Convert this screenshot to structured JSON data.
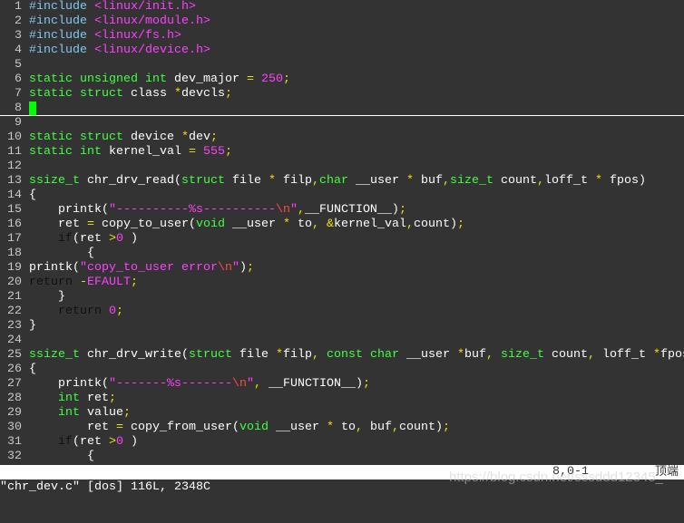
{
  "editor": {
    "colors": {
      "background": "#333333",
      "preprocessor": "#7cc8ec",
      "string": "#ff40ff",
      "type": "#40ff40",
      "operator": "#e8e800",
      "statement": "#111111",
      "special": "#ff4848",
      "cursor": "#00ff00"
    },
    "cursor_line": 8,
    "lines": [
      {
        "n": "1",
        "seg": [
          [
            "pp",
            "#include"
          ],
          [
            "tx",
            " "
          ],
          [
            "str",
            "<linux/init.h>"
          ]
        ]
      },
      {
        "n": "2",
        "seg": [
          [
            "pp",
            "#include"
          ],
          [
            "tx",
            " "
          ],
          [
            "str",
            "<linux/module.h>"
          ]
        ]
      },
      {
        "n": "3",
        "seg": [
          [
            "pp",
            "#include"
          ],
          [
            "tx",
            " "
          ],
          [
            "str",
            "<linux/fs.h>"
          ]
        ]
      },
      {
        "n": "4",
        "seg": [
          [
            "pp",
            "#include"
          ],
          [
            "tx",
            " "
          ],
          [
            "str",
            "<linux/device.h>"
          ]
        ]
      },
      {
        "n": "5",
        "seg": []
      },
      {
        "n": "6",
        "seg": [
          [
            "ty",
            "static"
          ],
          [
            "tx",
            " "
          ],
          [
            "ty",
            "unsigned"
          ],
          [
            "tx",
            " "
          ],
          [
            "ty",
            "int"
          ],
          [
            "tx",
            " dev_major "
          ],
          [
            "op",
            "="
          ],
          [
            "tx",
            " "
          ],
          [
            "str",
            "250"
          ],
          [
            "op",
            ";"
          ]
        ]
      },
      {
        "n": "7",
        "seg": [
          [
            "ty",
            "static"
          ],
          [
            "tx",
            " "
          ],
          [
            "ty",
            "struct"
          ],
          [
            "tx",
            " class "
          ],
          [
            "op",
            "*"
          ],
          [
            "tx",
            "devcls"
          ],
          [
            "op",
            ";"
          ]
        ]
      },
      {
        "n": "8",
        "seg": [],
        "cursor": true
      },
      {
        "n": "9",
        "seg": []
      },
      {
        "n": "10",
        "seg": [
          [
            "ty",
            "static"
          ],
          [
            "tx",
            " "
          ],
          [
            "ty",
            "struct"
          ],
          [
            "tx",
            " device "
          ],
          [
            "op",
            "*"
          ],
          [
            "tx",
            "dev"
          ],
          [
            "op",
            ";"
          ]
        ]
      },
      {
        "n": "11",
        "seg": [
          [
            "ty",
            "static"
          ],
          [
            "tx",
            " "
          ],
          [
            "ty",
            "int"
          ],
          [
            "tx",
            " kernel_val "
          ],
          [
            "op",
            "="
          ],
          [
            "tx",
            " "
          ],
          [
            "str",
            "555"
          ],
          [
            "op",
            ";"
          ]
        ]
      },
      {
        "n": "12",
        "seg": []
      },
      {
        "n": "13",
        "seg": [
          [
            "ty",
            "ssize_t"
          ],
          [
            "tx",
            " chr_drv_read("
          ],
          [
            "ty",
            "struct"
          ],
          [
            "tx",
            " file "
          ],
          [
            "op",
            "*"
          ],
          [
            "tx",
            " filp"
          ],
          [
            "op",
            ","
          ],
          [
            "ty",
            "char"
          ],
          [
            "tx",
            " __user "
          ],
          [
            "op",
            "*"
          ],
          [
            "tx",
            " buf"
          ],
          [
            "op",
            ","
          ],
          [
            "ty",
            "size_t"
          ],
          [
            "tx",
            " count"
          ],
          [
            "op",
            ","
          ],
          [
            "tx",
            "loff_t "
          ],
          [
            "op",
            "*"
          ],
          [
            "tx",
            " fpos)"
          ]
        ]
      },
      {
        "n": "14",
        "seg": [
          [
            "tx",
            "{"
          ]
        ]
      },
      {
        "n": "15",
        "seg": [
          [
            "tx",
            "    printk("
          ],
          [
            "str",
            "\"----------%s----------"
          ],
          [
            "sp",
            "\\n"
          ],
          [
            "str",
            "\""
          ],
          [
            "op",
            ","
          ],
          [
            "tx",
            "__FUNCTION__)"
          ],
          [
            "op",
            ";"
          ]
        ]
      },
      {
        "n": "16",
        "seg": [
          [
            "tx",
            "    ret "
          ],
          [
            "op",
            "="
          ],
          [
            "tx",
            " copy_to_user("
          ],
          [
            "ty",
            "void"
          ],
          [
            "tx",
            " __user "
          ],
          [
            "op",
            "*"
          ],
          [
            "tx",
            " to"
          ],
          [
            "op",
            ","
          ],
          [
            "tx",
            " "
          ],
          [
            "op",
            "&"
          ],
          [
            "tx",
            "kernel_val"
          ],
          [
            "op",
            ","
          ],
          [
            "tx",
            "count)"
          ],
          [
            "op",
            ";"
          ]
        ]
      },
      {
        "n": "17",
        "seg": [
          [
            "tx",
            "    "
          ],
          [
            "kw",
            "if"
          ],
          [
            "tx",
            "(ret "
          ],
          [
            "op",
            ">"
          ],
          [
            "str",
            "0"
          ],
          [
            "tx",
            " )"
          ]
        ]
      },
      {
        "n": "18",
        "seg": [
          [
            "tx",
            "        {"
          ]
        ]
      },
      {
        "n": "19",
        "seg": [
          [
            "tx",
            "printk("
          ],
          [
            "str",
            "\"copy_to_user error"
          ],
          [
            "sp",
            "\\n"
          ],
          [
            "str",
            "\""
          ],
          [
            "tx",
            ")"
          ],
          [
            "op",
            ";"
          ]
        ]
      },
      {
        "n": "20",
        "seg": [
          [
            "kw",
            "return"
          ],
          [
            "tx",
            " "
          ],
          [
            "op",
            "-"
          ],
          [
            "str",
            "EFAULT"
          ],
          [
            "op",
            ";"
          ]
        ]
      },
      {
        "n": "21",
        "seg": [
          [
            "tx",
            "    }"
          ]
        ]
      },
      {
        "n": "22",
        "seg": [
          [
            "tx",
            "    "
          ],
          [
            "kw",
            "return"
          ],
          [
            "tx",
            " "
          ],
          [
            "str",
            "0"
          ],
          [
            "op",
            ";"
          ]
        ]
      },
      {
        "n": "23",
        "seg": [
          [
            "tx",
            "}"
          ]
        ]
      },
      {
        "n": "24",
        "seg": []
      },
      {
        "n": "25",
        "seg": [
          [
            "ty",
            "ssize_t"
          ],
          [
            "tx",
            " chr_drv_write("
          ],
          [
            "ty",
            "struct"
          ],
          [
            "tx",
            " file "
          ],
          [
            "op",
            "*"
          ],
          [
            "tx",
            "filp"
          ],
          [
            "op",
            ","
          ],
          [
            "tx",
            " "
          ],
          [
            "ty",
            "const"
          ],
          [
            "tx",
            " "
          ],
          [
            "ty",
            "char"
          ],
          [
            "tx",
            " __user "
          ],
          [
            "op",
            "*"
          ],
          [
            "tx",
            "buf"
          ],
          [
            "op",
            ","
          ],
          [
            "tx",
            " "
          ],
          [
            "ty",
            "size_t"
          ],
          [
            "tx",
            " count"
          ],
          [
            "op",
            ","
          ],
          [
            "tx",
            " loff_t "
          ],
          [
            "op",
            "*"
          ],
          [
            "tx",
            "fpos"
          ]
        ]
      },
      {
        "n": "26",
        "seg": [
          [
            "tx",
            "{"
          ]
        ]
      },
      {
        "n": "27",
        "seg": [
          [
            "tx",
            "    printk("
          ],
          [
            "str",
            "\"-------%s-------"
          ],
          [
            "sp",
            "\\n"
          ],
          [
            "str",
            "\""
          ],
          [
            "op",
            ","
          ],
          [
            "tx",
            " __FUNCTION__)"
          ],
          [
            "op",
            ";"
          ]
        ]
      },
      {
        "n": "28",
        "seg": [
          [
            "tx",
            "    "
          ],
          [
            "ty",
            "int"
          ],
          [
            "tx",
            " ret"
          ],
          [
            "op",
            ";"
          ]
        ]
      },
      {
        "n": "29",
        "seg": [
          [
            "tx",
            "    "
          ],
          [
            "ty",
            "int"
          ],
          [
            "tx",
            " value"
          ],
          [
            "op",
            ";"
          ]
        ]
      },
      {
        "n": "30",
        "seg": [
          [
            "tx",
            "        ret "
          ],
          [
            "op",
            "="
          ],
          [
            "tx",
            " copy_from_user("
          ],
          [
            "ty",
            "void"
          ],
          [
            "tx",
            " __user "
          ],
          [
            "op",
            "*"
          ],
          [
            "tx",
            " to"
          ],
          [
            "op",
            ","
          ],
          [
            "tx",
            " buf"
          ],
          [
            "op",
            ","
          ],
          [
            "tx",
            "count)"
          ],
          [
            "op",
            ";"
          ]
        ]
      },
      {
        "n": "31",
        "seg": [
          [
            "tx",
            "    "
          ],
          [
            "kw",
            "if"
          ],
          [
            "tx",
            "(ret "
          ],
          [
            "op",
            ">"
          ],
          [
            "str",
            "0"
          ],
          [
            "tx",
            " )"
          ]
        ]
      },
      {
        "n": "32",
        "seg": [
          [
            "tx",
            "        {"
          ]
        ]
      }
    ]
  },
  "statusline": {
    "filename": "chr_dev.c",
    "position": "8,0-1",
    "scroll": "顶端"
  },
  "cmdline": {
    "message": "\"chr_dev.c\" [dos] 116L, 2348C"
  },
  "watermark": "https://blog.csdn.net/sssddd12345_"
}
